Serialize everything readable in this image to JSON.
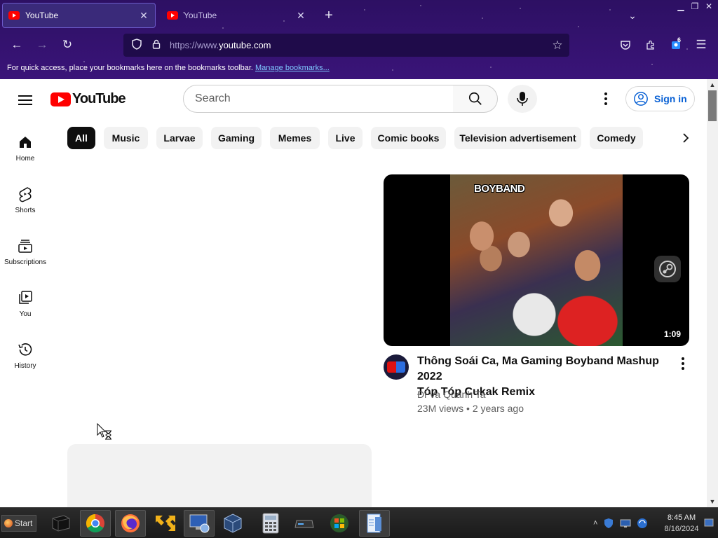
{
  "browser": {
    "tabs": [
      {
        "title": "YouTube",
        "active": true
      },
      {
        "title": "YouTube",
        "active": false
      }
    ],
    "url_prefix": "https://www.",
    "url_domain": "youtube.com",
    "bookmarks_hint": "For quick access, place your bookmarks here on the bookmarks toolbar.",
    "bookmarks_link": "Manage bookmarks...",
    "extension_badge": "6"
  },
  "youtube": {
    "logo_text": "YouTube",
    "search_placeholder": "Search",
    "sign_in_label": "Sign in",
    "guide": [
      {
        "label": "Home",
        "icon": "home-icon"
      },
      {
        "label": "Shorts",
        "icon": "shorts-icon"
      },
      {
        "label": "Subscriptions",
        "icon": "subscriptions-icon"
      },
      {
        "label": "You",
        "icon": "you-icon"
      },
      {
        "label": "History",
        "icon": "history-icon"
      }
    ],
    "chips": [
      "All",
      "Music",
      "Larvae",
      "Gaming",
      "Memes",
      "Live",
      "Comic books",
      "Television advertisement",
      "Comedy"
    ],
    "selected_chip": "All",
    "video": {
      "thumbnail_text": "BOYBAND",
      "duration": "1:09",
      "title_line1": "Thông Soái Ca, Ma Gaming Boyband Mashup 2022",
      "title_line2": "Tóp Tóp Cukak Remix",
      "channel": "Đi Va Quanh Ta",
      "views": "23M views",
      "age": "2 years ago"
    }
  },
  "taskbar": {
    "start_label": "Start",
    "apps": [
      "terminal-icon",
      "chrome-icon",
      "firefox-icon",
      "arrows-app-icon",
      "network-app-icon",
      "virtualbox-icon",
      "calculator-icon",
      "drive-icon",
      "windows-logo-icon",
      "notepad-icon"
    ],
    "time": "8:45 AM",
    "date": "8/16/2024"
  },
  "colors": {
    "brand_red": "#ff0000",
    "link_blue": "#065fd4",
    "chrome_purple": "#2d1063"
  }
}
